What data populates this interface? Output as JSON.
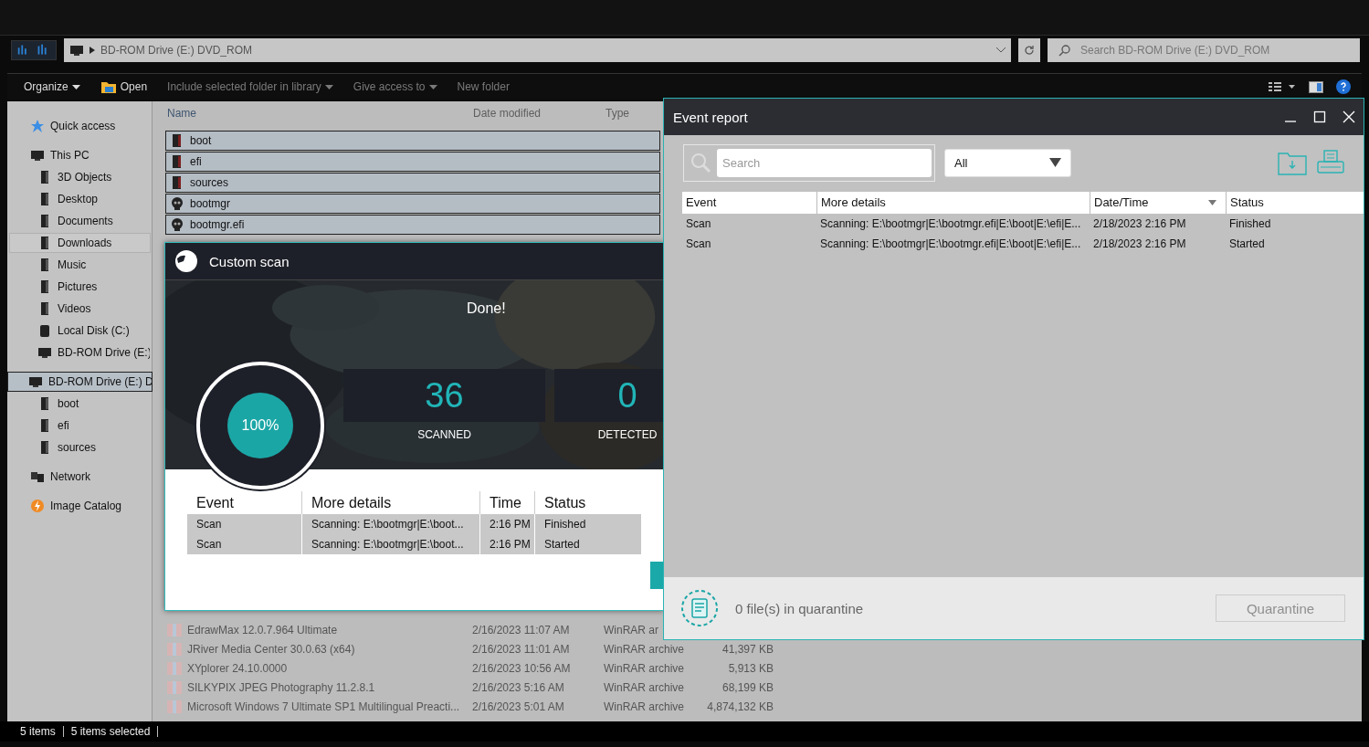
{
  "explorer": {
    "address": {
      "path": "BD-ROM Drive (E:) DVD_ROM"
    },
    "search": {
      "placeholder": "Search BD-ROM Drive (E:) DVD_ROM"
    },
    "toolbar": [
      {
        "label": "Organize",
        "kind": "menu",
        "disabled": false
      },
      {
        "label": "Open",
        "kind": "open",
        "disabled": false
      },
      {
        "label": "Include selected folder in library",
        "kind": "menu",
        "disabled": true
      },
      {
        "label": "Give access to",
        "kind": "menu",
        "disabled": true
      },
      {
        "label": "New folder",
        "kind": "plain",
        "disabled": true
      }
    ],
    "sidebar": {
      "items": [
        {
          "label": "Quick access",
          "kind": "star",
          "selected": false,
          "highlighted": false
        },
        {
          "label": "This PC",
          "kind": "pc",
          "selected": false,
          "highlighted": false,
          "children": [
            {
              "label": "3D Objects",
              "kind": "folder",
              "selected": false,
              "highlighted": false
            },
            {
              "label": "Desktop",
              "kind": "folder",
              "selected": false,
              "highlighted": false
            },
            {
              "label": "Documents",
              "kind": "folder",
              "selected": false,
              "highlighted": false
            },
            {
              "label": "Downloads",
              "kind": "folder",
              "selected": false,
              "highlighted": true
            },
            {
              "label": "Music",
              "kind": "folder",
              "selected": false,
              "highlighted": false
            },
            {
              "label": "Pictures",
              "kind": "folder",
              "selected": false,
              "highlighted": false
            },
            {
              "label": "Videos",
              "kind": "folder",
              "selected": false,
              "highlighted": false
            },
            {
              "label": "Local Disk (C:)",
              "kind": "drive",
              "selected": false,
              "highlighted": false
            },
            {
              "label": "BD-ROM Drive (E:)",
              "kind": "pc",
              "selected": false,
              "highlighted": false
            }
          ]
        },
        {
          "label": "BD-ROM Drive (E:) D",
          "kind": "pc",
          "selected": true,
          "highlighted": false,
          "children": [
            {
              "label": "boot",
              "kind": "folder",
              "selected": false,
              "highlighted": false
            },
            {
              "label": "efi",
              "kind": "folder",
              "selected": false,
              "highlighted": false
            },
            {
              "label": "sources",
              "kind": "folder",
              "selected": false,
              "highlighted": false
            }
          ]
        },
        {
          "label": "Network",
          "kind": "network",
          "selected": false,
          "highlighted": false
        },
        {
          "label": "Image Catalog",
          "kind": "catalog",
          "selected": false,
          "highlighted": false
        }
      ]
    },
    "file_list": {
      "columns": [
        "Name",
        "Date modified",
        "Type"
      ],
      "selected_items": [
        {
          "name": "boot",
          "kind": "folder"
        },
        {
          "name": "efi",
          "kind": "folder"
        },
        {
          "name": "sources",
          "kind": "folder"
        },
        {
          "name": "bootmgr",
          "kind": "file"
        },
        {
          "name": "bootmgr.efi",
          "kind": "file"
        }
      ],
      "rows": [
        {
          "name": "EdrawMax 12.0.7.964 Ultimate",
          "date": "2/16/2023 11:07 AM",
          "type": "WinRAR ar"
        },
        {
          "name": "JRiver Media Center 30.0.63 (x64)",
          "date": "2/16/2023 11:01 AM",
          "type": "WinRAR archive",
          "size": "41,397 KB"
        },
        {
          "name": "XYplorer 24.10.0000",
          "date": "2/16/2023 10:56 AM",
          "type": "WinRAR archive",
          "size": "5,913 KB"
        },
        {
          "name": "SILKYPIX JPEG Photography 11.2.8.1",
          "date": "2/16/2023 5:16 AM",
          "type": "WinRAR archive",
          "size": "68,199 KB"
        },
        {
          "name": "Microsoft Windows 7 Ultimate SP1 Multilingual Preacti...",
          "date": "2/16/2023 5:01 AM",
          "type": "WinRAR archive",
          "size": "4,874,132 KB"
        }
      ]
    },
    "status_bar": {
      "items": "5 items",
      "selected": "5 items selected"
    }
  },
  "custom_scan": {
    "title": "Custom scan",
    "message": "Done!",
    "progress": {
      "level": 1,
      "text": "100%"
    },
    "stats": [
      {
        "value": "36",
        "label": "SCANNED"
      },
      {
        "value": "0",
        "label": "DETECTED"
      }
    ],
    "table": {
      "columns": [
        "Event",
        "More details",
        "Time",
        "Status"
      ],
      "rows": [
        [
          "Scan",
          "Scanning: E:\\bootmgr|E:\\boot...",
          "2:16 PM",
          "Finished"
        ],
        [
          "Scan",
          "Scanning: E:\\bootmgr|E:\\boot...",
          "2:16 PM",
          "Started"
        ]
      ]
    }
  },
  "event_report": {
    "title": "Event report",
    "search": {
      "placeholder": "Search"
    },
    "filter": "All",
    "columns": [
      {
        "label": "Event",
        "sorted": false
      },
      {
        "label": "More details",
        "sorted": false
      },
      {
        "label": "Date/Time",
        "sorted": true
      },
      {
        "label": "Status",
        "sorted": false
      }
    ],
    "rows": [
      [
        "Scan",
        "Scanning: E:\\bootmgr|E:\\bootmgr.efi|E:\\boot|E:\\efi|E...",
        "2/18/2023 2:16 PM",
        "Finished"
      ],
      [
        "Scan",
        "Scanning: E:\\bootmgr|E:\\bootmgr.efi|E:\\boot|E:\\efi|E...",
        "2/18/2023 2:16 PM",
        "Started"
      ]
    ],
    "quarantine": {
      "text": "0 file(s) in quarantine",
      "button": "Quarantine",
      "disabled": true
    }
  }
}
